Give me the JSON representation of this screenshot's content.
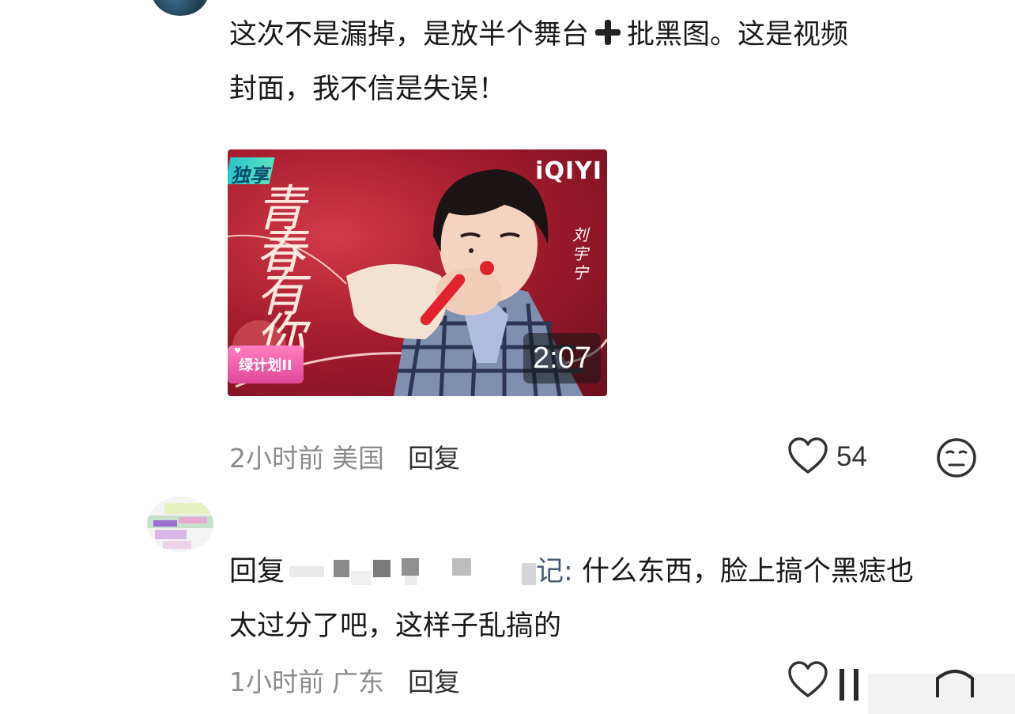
{
  "comment1": {
    "text_part1": "这次不是漏掉，是放半个舞台",
    "text_part2": "批黑图。这是视频",
    "text_line2": "封面，我不信是失误！",
    "video": {
      "badge": "独享",
      "brand": "iQIYI",
      "title": "青春有你",
      "singer": "刘宇宁",
      "logo": "绿计划II",
      "duration": "2:07"
    },
    "meta": {
      "time": "2小时前",
      "location": "美国",
      "reply": "回复"
    },
    "likes": "54"
  },
  "comment2": {
    "reply_prefix": "回复",
    "name_suffix": "记:",
    "text_part1": "什么东西，脸上搞个黑痣也",
    "text_line2": "太过分了吧，这样子乱搞的",
    "meta": {
      "time": "1小时前",
      "location": "广东",
      "reply": "回复"
    }
  },
  "icons": {
    "plus": "plus-icon",
    "like": "heart-icon",
    "face": "expressionless-face-icon"
  }
}
